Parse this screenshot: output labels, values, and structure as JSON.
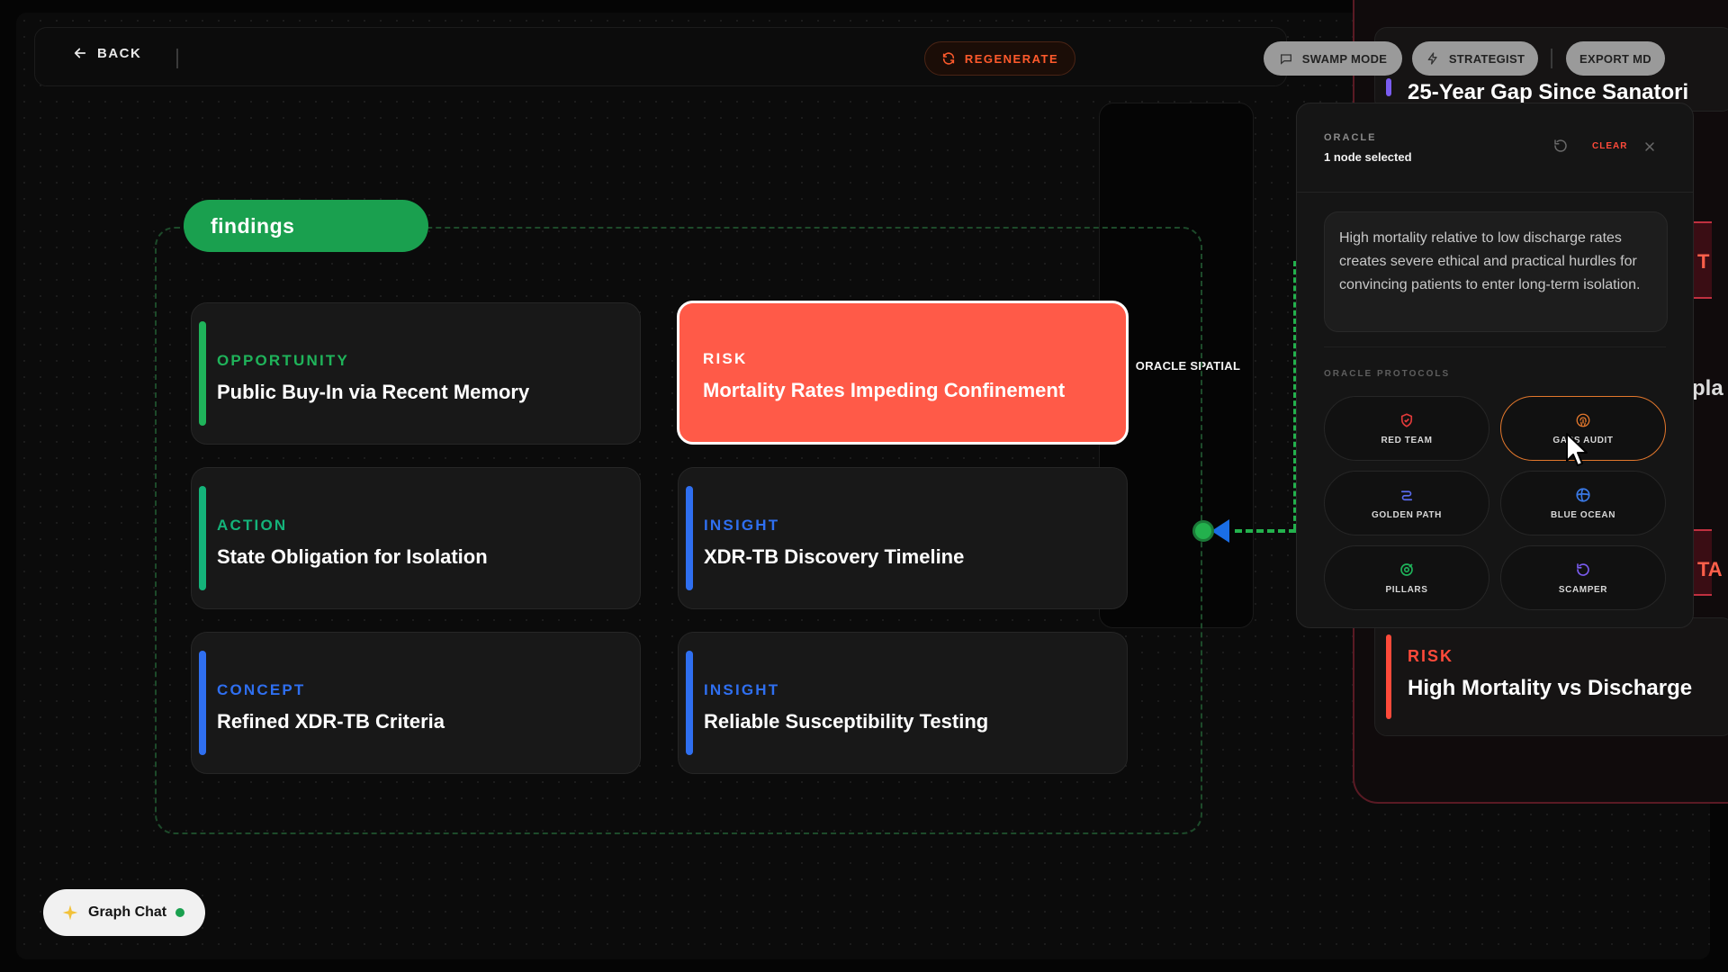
{
  "topbar": {
    "back_label": "BACK",
    "regenerate_label": "REGENERATE",
    "oracle_spatial_label": "ORACLE SPATIAL",
    "swamp_mode_label": "SWAMP MODE",
    "strategist_label": "STRATEGIST",
    "export_label": "EXPORT MD"
  },
  "group": {
    "label": "findings"
  },
  "nodes": [
    {
      "kind": "OPPORTUNITY",
      "title": "Public Buy-In via Recent Memory",
      "color": "#1fb35a"
    },
    {
      "kind": "RISK",
      "title": "Mortality Rates Impeding Confinement",
      "color": "#ff5a48",
      "selected": true
    },
    {
      "kind": "ACTION",
      "title": "State Obligation for Isolation",
      "color": "#14b37a"
    },
    {
      "kind": "INSIGHT",
      "title": "XDR-TB Discovery Timeline",
      "color": "#2f6ff0"
    },
    {
      "kind": "CONCEPT",
      "title": "Refined XDR-TB Criteria",
      "color": "#2f6ff0"
    },
    {
      "kind": "INSIGHT",
      "title": "Reliable Susceptibility Testing",
      "color": "#2f6ff0"
    }
  ],
  "background": {
    "top_card_title": "25-Year Gap Since Sanatori",
    "bottom_card_kind": "RISK",
    "bottom_card_title": "High Mortality vs Discharge",
    "edge_letter_1": "T",
    "edge_letter_2": "TA",
    "partial_text": "pla"
  },
  "oracle": {
    "kicker": "ORACLE",
    "selection": "1 node selected",
    "clear_label": "CLEAR",
    "summary": "High mortality relative to low discharge rates creates severe ethical and practical hurdles for convincing patients to enter long-term isolation.",
    "protocols_label": "ORACLE PROTOCOLS",
    "protocols": [
      {
        "label": "RED TEAM",
        "icon": "shield-icon",
        "color": "#e23a3a"
      },
      {
        "label": "GAPS AUDIT",
        "icon": "fingerprint-icon",
        "color": "#e2772c",
        "active": true
      },
      {
        "label": "GOLDEN PATH",
        "icon": "route-icon",
        "color": "#5a6cf0"
      },
      {
        "label": "BLUE OCEAN",
        "icon": "globe-icon",
        "color": "#3a7ae8"
      },
      {
        "label": "PILLARS",
        "icon": "target-icon",
        "color": "#1fb35a"
      },
      {
        "label": "SCAMPER",
        "icon": "rotate-icon",
        "color": "#7a5cf0"
      }
    ]
  },
  "graph_chat": {
    "label": "Graph Chat",
    "status_color": "#1aa04f"
  }
}
